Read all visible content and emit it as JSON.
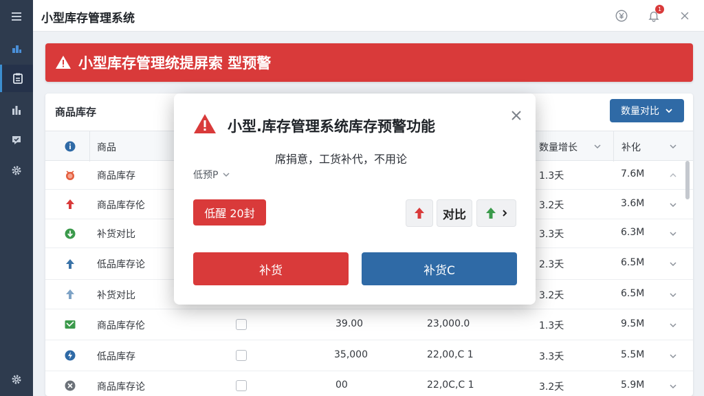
{
  "app": {
    "title": "小型库存管理系统"
  },
  "colors": {
    "sidebar": "#2e3b4e",
    "danger": "#d93a3a",
    "primary": "#2f6aa6",
    "success": "#3b9a4b"
  },
  "banner": {
    "text": "小型库存管理统提屏索 型预警"
  },
  "notifications": {
    "count": "1"
  },
  "panel": {
    "title": "商品库存",
    "compare_button": "数量对比",
    "columns": [
      "商品",
      "数量增长",
      "补化"
    ]
  },
  "rows": [
    {
      "icon": "alarm-icon",
      "name": "商品库存",
      "qty": "",
      "price": "",
      "growth": "1.3夭",
      "amount": "7.6M"
    },
    {
      "icon": "arrow-up-icon",
      "name": "商品库存伦",
      "qty": "",
      "price": "",
      "growth": "3.2夭",
      "amount": "3.6M"
    },
    {
      "icon": "arrow-down-circle-icon",
      "name": "补货对比",
      "qty": "",
      "price": "",
      "growth": "3.3夭",
      "amount": "6.3M"
    },
    {
      "icon": "arrow-up-icon",
      "name": "低品库存论",
      "qty": "",
      "price": "",
      "growth": "2.3夭",
      "amount": "6.5M"
    },
    {
      "icon": "arrow-up-icon",
      "name": "补货对比",
      "qty": "",
      "price": "",
      "growth": "3.2夭",
      "amount": "6.5M"
    },
    {
      "icon": "chart-icon",
      "name": "商品库存伦",
      "qty": "39.00",
      "price": "23,000.0",
      "growth": "1.3夭",
      "amount": "9.5M"
    },
    {
      "icon": "bolt-icon",
      "name": "低品库存",
      "qty": "35,000",
      "price": "22,00,C 1",
      "growth": "3.3夭",
      "amount": "5.5M"
    },
    {
      "icon": "close-circle-icon",
      "name": "商品库存论",
      "qty": "00",
      "price": "22,0C,C 1",
      "growth": "3.2夭",
      "amount": "5.9M"
    }
  ],
  "modal": {
    "title": "小型.库存管理系统库存预警功能",
    "description": "席捐意，工货补代，不用论",
    "filter_label": "低预P",
    "low_badge": "低醒 20封",
    "compare_label": "对比",
    "primary_action": "补货",
    "secondary_action": "补货C"
  }
}
